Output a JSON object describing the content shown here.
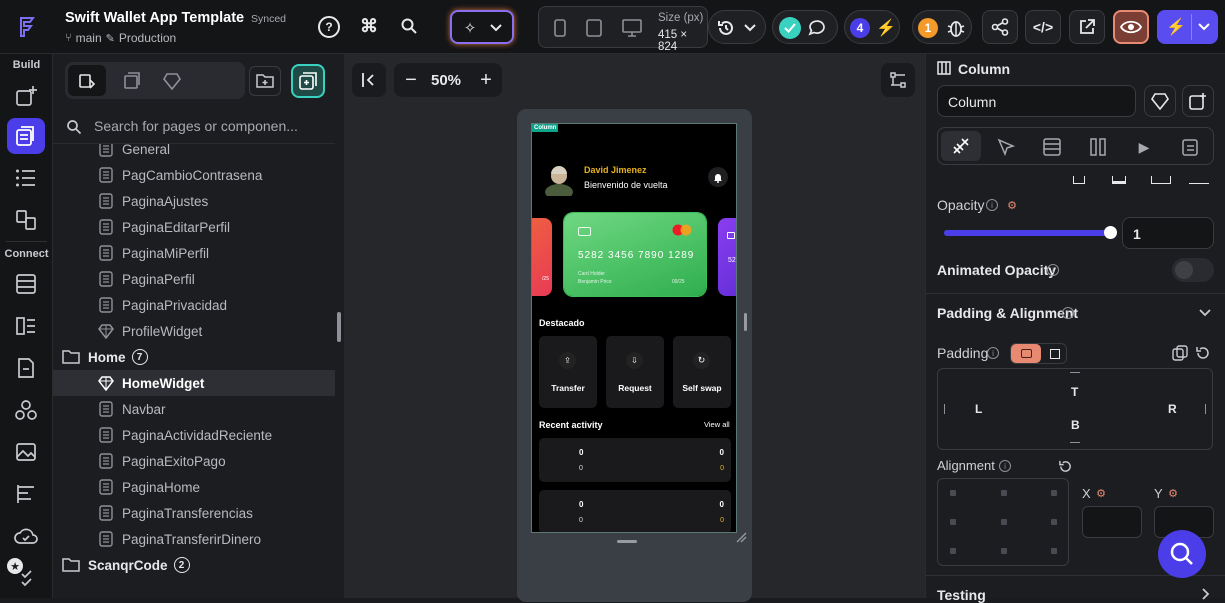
{
  "app": {
    "title": "Swift Wallet App Template",
    "sync_status": "Synced",
    "branch": "main",
    "environment": "Production"
  },
  "topbar": {
    "size_label": "Size (px)",
    "size_value": "415 × 824",
    "issues_count": "4",
    "warnings_count": "1"
  },
  "rail": {
    "build_label": "Build",
    "connect_label": "Connect"
  },
  "left": {
    "search_placeholder": "Search for pages or componen...",
    "items": [
      {
        "label": "General",
        "type": "page"
      },
      {
        "label": "PagCambioContrasena",
        "type": "page"
      },
      {
        "label": "PaginaAjustes",
        "type": "page"
      },
      {
        "label": "PaginaEditarPerfil",
        "type": "page"
      },
      {
        "label": "PaginaMiPerfil",
        "type": "page"
      },
      {
        "label": "PaginaPerfil",
        "type": "page"
      },
      {
        "label": "PaginaPrivacidad",
        "type": "page"
      },
      {
        "label": "ProfileWidget",
        "type": "component"
      }
    ],
    "home_folder": {
      "label": "Home",
      "count": "7"
    },
    "home_items": [
      {
        "label": "HomeWidget",
        "type": "component",
        "selected": true
      },
      {
        "label": "Navbar",
        "type": "page"
      },
      {
        "label": "PaginaActividadReciente",
        "type": "page"
      },
      {
        "label": "PaginaExitoPago",
        "type": "page"
      },
      {
        "label": "PaginaHome",
        "type": "page"
      },
      {
        "label": "PaginaTransferencias",
        "type": "page"
      },
      {
        "label": "PaginaTransferirDinero",
        "type": "page"
      }
    ],
    "scan_folder": {
      "label": "ScanqrCode",
      "count": "2"
    }
  },
  "canvas": {
    "zoom": "50%"
  },
  "phone": {
    "column_tag": "Column",
    "user_name": "David Jimenez",
    "greeting": "Bienvenido de vuelta",
    "card_number": "5282 3456 7890 1289",
    "card_holder_label": "Card Holder",
    "card_holder": "Benjamin Price",
    "card_expiry": "09/25",
    "side_card_number": "52",
    "side_left_text": "/25",
    "featured_title": "Destacado",
    "actions": [
      {
        "label": "Transfer",
        "icon": "upload-icon"
      },
      {
        "label": "Request",
        "icon": "download-icon"
      },
      {
        "label": "Self swap",
        "icon": "refresh-icon"
      }
    ],
    "recent_title": "Recent activity",
    "view_all": "View all",
    "activity": [
      {
        "top": "0",
        "bottom": "0",
        "left1": "0",
        "left2": "0"
      },
      {
        "top": "0",
        "bottom": "0",
        "left1": "0",
        "left2": "0"
      }
    ]
  },
  "properties": {
    "widget_type": "Column",
    "widget_name": "Column",
    "opacity_label": "Opacity",
    "opacity_value": "1",
    "opacity_level": 1,
    "animated_opacity_label": "Animated Opacity",
    "padding_section": "Padding & Alignment",
    "padding_label": "Padding",
    "pad_t": "T",
    "pad_b": "B",
    "pad_l": "L",
    "pad_r": "R",
    "alignment_label": "Alignment",
    "x_label": "X",
    "y_label": "Y",
    "testing_label": "Testing"
  },
  "colors": {
    "accent": "#4b3ee8",
    "teal": "#39d2c0",
    "gold": "#e8b321",
    "orange": "#f49a2b",
    "purple_btn": "#5a4df0",
    "eye_btn": "#e88a72"
  }
}
